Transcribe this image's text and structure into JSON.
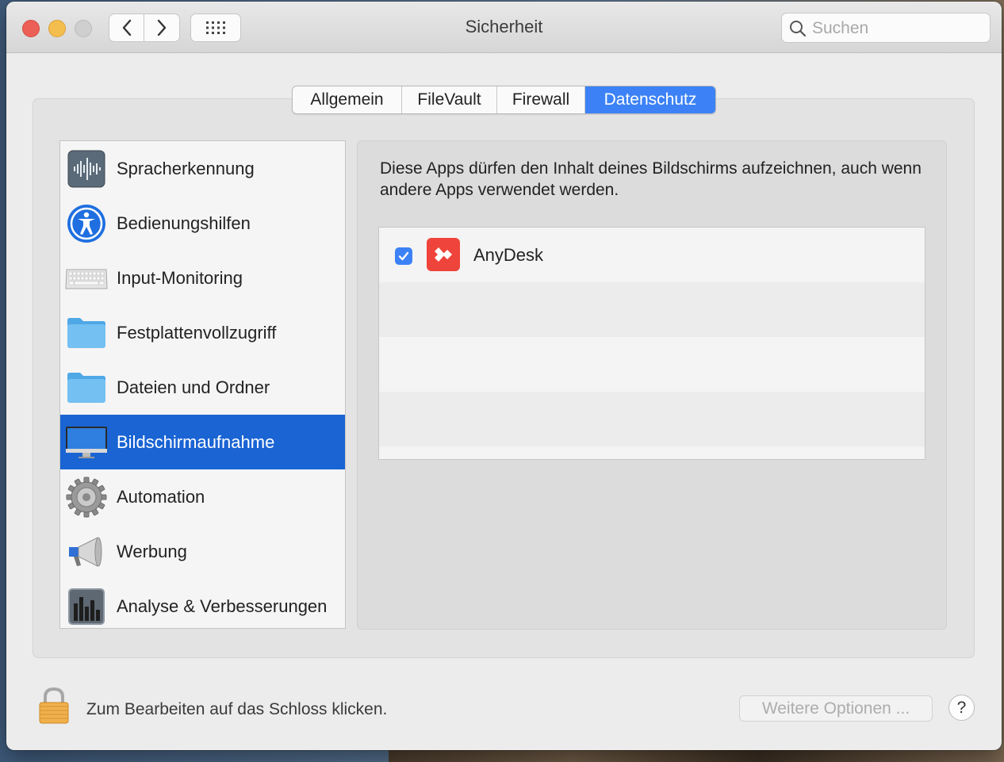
{
  "window": {
    "title": "Sicherheit"
  },
  "toolbar": {
    "back_icon": "chevron-left-icon",
    "forward_icon": "chevron-right-icon",
    "grid_icon": "grid-icon"
  },
  "search": {
    "placeholder": "Suchen",
    "value": ""
  },
  "tabs": [
    {
      "label": "Allgemein",
      "active": false
    },
    {
      "label": "FileVault",
      "active": false
    },
    {
      "label": "Firewall",
      "active": false
    },
    {
      "label": "Datenschutz",
      "active": true
    }
  ],
  "sidebar": {
    "items": [
      {
        "label": "Spracherkennung",
        "icon": "waveform-icon",
        "selected": false
      },
      {
        "label": "Bedienungshilfen",
        "icon": "accessibility-icon",
        "selected": false
      },
      {
        "label": "Input-Monitoring",
        "icon": "keyboard-icon",
        "selected": false
      },
      {
        "label": "Festplattenvollzugriff",
        "icon": "folder-icon",
        "selected": false
      },
      {
        "label": "Dateien und Ordner",
        "icon": "folder-icon",
        "selected": false
      },
      {
        "label": "Bildschirmaufnahme",
        "icon": "display-icon",
        "selected": true
      },
      {
        "label": "Automation",
        "icon": "gear-icon",
        "selected": false
      },
      {
        "label": "Werbung",
        "icon": "megaphone-icon",
        "selected": false
      },
      {
        "label": "Analyse & Verbesserungen",
        "icon": "bar-chart-icon",
        "selected": false
      }
    ]
  },
  "panel": {
    "description": "Diese Apps dürfen den Inhalt deines Bildschirms aufzeichnen, auch wenn andere Apps verwendet werden.",
    "apps": [
      {
        "name": "AnyDesk",
        "checked": true,
        "icon": "anydesk-icon"
      }
    ]
  },
  "footer": {
    "lock_text": "Zum Bearbeiten auf das Schloss klicken.",
    "more_options": "Weitere Optionen ...",
    "help": "?"
  },
  "colors": {
    "accent": "#3c82f6",
    "selection": "#1a64d3",
    "anydesk": "#ef443b"
  }
}
